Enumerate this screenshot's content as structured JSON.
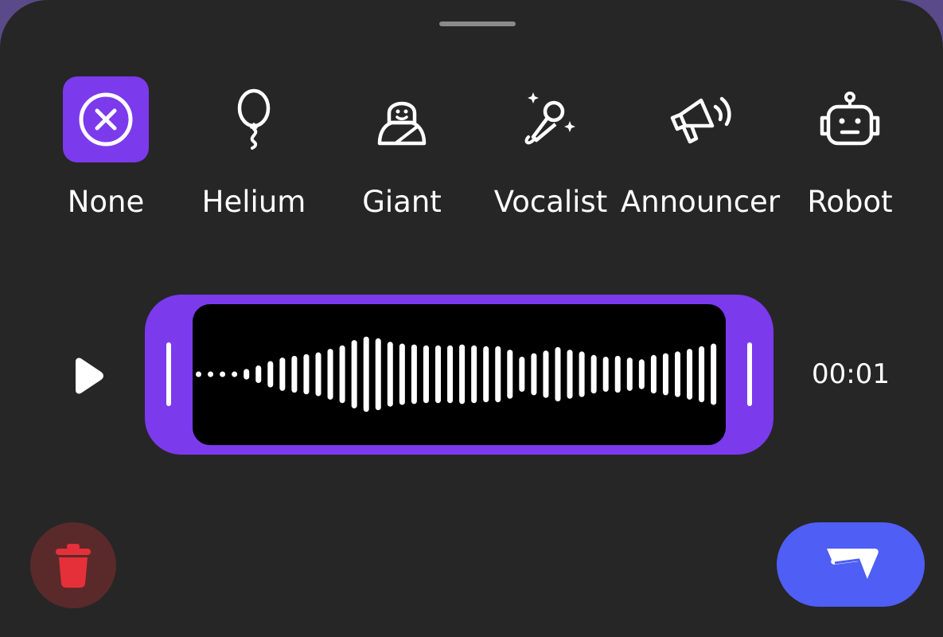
{
  "effects": [
    {
      "label": "None",
      "icon": "cancel-circle-icon",
      "selected": true
    },
    {
      "label": "Helium",
      "icon": "balloon-icon",
      "selected": false
    },
    {
      "label": "Giant",
      "icon": "giant-figure-icon",
      "selected": false
    },
    {
      "label": "Vocalist",
      "icon": "microphone-sparkle-icon",
      "selected": false
    },
    {
      "label": "Announcer",
      "icon": "megaphone-icon",
      "selected": false
    },
    {
      "label": "Robot",
      "icon": "robot-icon",
      "selected": false
    }
  ],
  "player": {
    "duration": "00:01",
    "play_icon": "play-icon",
    "waveform_levels": [
      0.04,
      0.04,
      0.05,
      0.06,
      0.12,
      0.2,
      0.3,
      0.38,
      0.42,
      0.46,
      0.5,
      0.58,
      0.66,
      0.78,
      0.86,
      0.82,
      0.74,
      0.7,
      0.68,
      0.66,
      0.66,
      0.66,
      0.68,
      0.66,
      0.64,
      0.64,
      0.56,
      0.4,
      0.48,
      0.54,
      0.62,
      0.56,
      0.52,
      0.44,
      0.4,
      0.42,
      0.38,
      0.34,
      0.44,
      0.48,
      0.52,
      0.58,
      0.64,
      0.7
    ]
  },
  "actions": {
    "delete_icon": "trash-icon",
    "send_icon": "send-icon"
  },
  "colors": {
    "accent": "#7c3aed",
    "send": "#4f5ef5",
    "delete": "#e5303a",
    "background": "#262626"
  }
}
